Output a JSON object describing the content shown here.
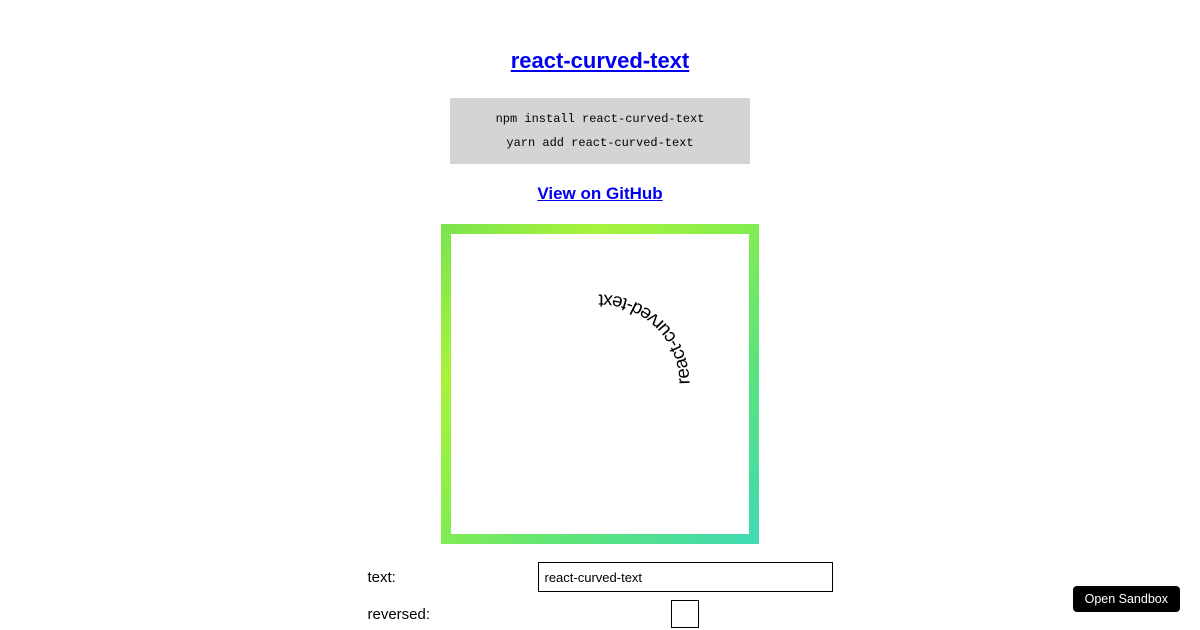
{
  "title": "react-curved-text",
  "install": {
    "npm": "npm install react-curved-text",
    "yarn": "yarn add react-curved-text"
  },
  "github_link": "View on GitHub",
  "demo": {
    "curved_text": "react-curved-text"
  },
  "form": {
    "text_label": "text:",
    "text_value": "react-curved-text",
    "reversed_label": "reversed:"
  },
  "sandbox_button": "Open Sandbox"
}
